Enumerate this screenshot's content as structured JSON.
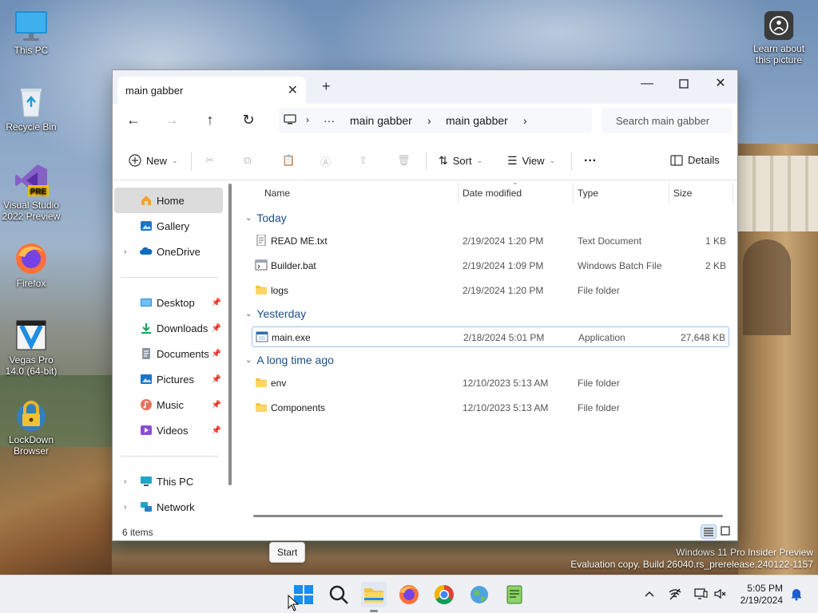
{
  "desktop": {
    "icons": [
      {
        "label": "This PC",
        "icon": "monitor-icon"
      },
      {
        "label": "Recycle Bin",
        "icon": "recycle-bin-icon"
      },
      {
        "label": "Visual Studio 2022 Preview",
        "icon": "visual-studio-icon",
        "badge": "PRE"
      },
      {
        "label": "Firefox",
        "icon": "firefox-icon"
      },
      {
        "label": "Vegas Pro 14.0 (64-bit)",
        "icon": "vegas-pro-icon"
      },
      {
        "label": "LockDown Browser",
        "icon": "lockdown-browser-icon"
      }
    ],
    "learn_about": "Learn about this picture",
    "watermark_line1": "Windows 11 Pro Insider Preview",
    "watermark_line2": "Evaluation copy. Build 26040.rs_prerelease.240122-1157"
  },
  "explorer": {
    "tab_title": "main gabber",
    "address": {
      "ellipsis": "···",
      "crumbs": [
        "main gabber",
        "main gabber"
      ]
    },
    "search_placeholder": "Search main gabber",
    "commands": {
      "new": "New",
      "sort": "Sort",
      "view": "View",
      "more": "···",
      "details": "Details"
    },
    "sidebar": {
      "top": [
        {
          "label": "Home",
          "icon": "home-icon",
          "selected": true
        },
        {
          "label": "Gallery",
          "icon": "gallery-icon"
        },
        {
          "label": "OneDrive",
          "icon": "onedrive-icon",
          "expandable": true
        }
      ],
      "quick": [
        {
          "label": "Desktop",
          "icon": "desktop-icon"
        },
        {
          "label": "Downloads",
          "icon": "downloads-icon"
        },
        {
          "label": "Documents",
          "icon": "documents-icon"
        },
        {
          "label": "Pictures",
          "icon": "pictures-icon"
        },
        {
          "label": "Music",
          "icon": "music-icon"
        },
        {
          "label": "Videos",
          "icon": "videos-icon"
        }
      ],
      "bottom": [
        {
          "label": "This PC",
          "icon": "this-pc-icon"
        },
        {
          "label": "Network",
          "icon": "network-icon"
        }
      ]
    },
    "columns": {
      "name": "Name",
      "date": "Date modified",
      "type": "Type",
      "size": "Size"
    },
    "groups": [
      {
        "label": "Today",
        "files": [
          {
            "name": "READ ME.txt",
            "date": "2/19/2024 1:20 PM",
            "type": "Text Document",
            "size": "1 KB",
            "icon": "text-file-icon"
          },
          {
            "name": "Builder.bat",
            "date": "2/19/2024 1:09 PM",
            "type": "Windows Batch File",
            "size": "2 KB",
            "icon": "batch-file-icon"
          },
          {
            "name": "logs",
            "date": "2/19/2024 1:20 PM",
            "type": "File folder",
            "size": "",
            "icon": "folder-icon"
          }
        ]
      },
      {
        "label": "Yesterday",
        "files": [
          {
            "name": "main.exe",
            "date": "2/18/2024 5:01 PM",
            "type": "Application",
            "size": "27,648 KB",
            "icon": "exe-file-icon",
            "selected": true
          }
        ]
      },
      {
        "label": "A long time ago",
        "files": [
          {
            "name": "env",
            "date": "12/10/2023 5:13 AM",
            "type": "File folder",
            "size": "",
            "icon": "folder-icon"
          },
          {
            "name": "Components",
            "date": "12/10/2023 5:13 AM",
            "type": "File folder",
            "size": "",
            "icon": "folder-icon"
          }
        ]
      }
    ],
    "status": "6 items"
  },
  "tooltip": "Start",
  "taskbar": {
    "apps": [
      "start-icon",
      "search-icon",
      "file-explorer-icon",
      "firefox-icon",
      "chrome-icon",
      "world-icon",
      "notepad-icon"
    ],
    "time": "5:05 PM",
    "date": "2/19/2024"
  },
  "colors": {
    "accent": "#0067c0",
    "folder": "#f5c542",
    "selection_border": "#9ec5f0"
  }
}
